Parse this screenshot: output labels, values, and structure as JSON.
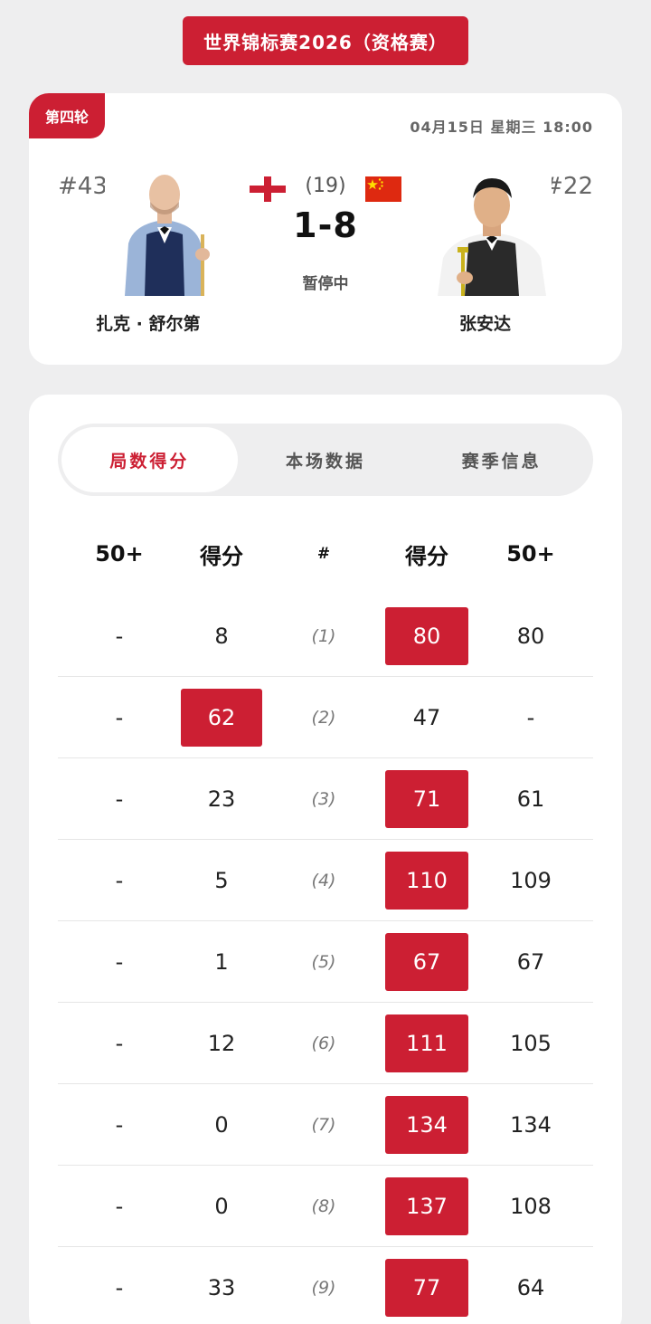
{
  "event_title": "世界锦标赛2026（资格赛）",
  "match": {
    "round": "第四轮",
    "datetime": "04月15日  星期三  18:00",
    "best_of": "(19)",
    "score": "1-8",
    "status": "暂停中",
    "left_player": {
      "rank": "#43",
      "name": "扎克 · 舒尔第",
      "flag": "england-flag"
    },
    "right_player": {
      "rank": "#22",
      "name": "张安达",
      "flag": "china-flag"
    }
  },
  "tabs": [
    {
      "label": "局数得分",
      "active": true
    },
    {
      "label": "本场数据",
      "active": false
    },
    {
      "label": "赛季信息",
      "active": false
    }
  ],
  "table": {
    "headers": [
      "50+",
      "得分",
      "#",
      "得分",
      "50+"
    ],
    "rows": [
      {
        "l50": "-",
        "lscore": "8",
        "frame": "(1)",
        "rscore": "80",
        "r50": "80",
        "winner": "right"
      },
      {
        "l50": "-",
        "lscore": "62",
        "frame": "(2)",
        "rscore": "47",
        "r50": "-",
        "winner": "left"
      },
      {
        "l50": "-",
        "lscore": "23",
        "frame": "(3)",
        "rscore": "71",
        "r50": "61",
        "winner": "right"
      },
      {
        "l50": "-",
        "lscore": "5",
        "frame": "(4)",
        "rscore": "110",
        "r50": "109",
        "winner": "right"
      },
      {
        "l50": "-",
        "lscore": "1",
        "frame": "(5)",
        "rscore": "67",
        "r50": "67",
        "winner": "right"
      },
      {
        "l50": "-",
        "lscore": "12",
        "frame": "(6)",
        "rscore": "111",
        "r50": "105",
        "winner": "right"
      },
      {
        "l50": "-",
        "lscore": "0",
        "frame": "(7)",
        "rscore": "134",
        "r50": "134",
        "winner": "right"
      },
      {
        "l50": "-",
        "lscore": "0",
        "frame": "(8)",
        "rscore": "137",
        "r50": "108",
        "winner": "right"
      },
      {
        "l50": "-",
        "lscore": "33",
        "frame": "(9)",
        "rscore": "77",
        "r50": "64",
        "winner": "right"
      }
    ]
  },
  "colors": {
    "accent": "#cc1f33",
    "background": "#eeeeef",
    "card": "#ffffff"
  }
}
